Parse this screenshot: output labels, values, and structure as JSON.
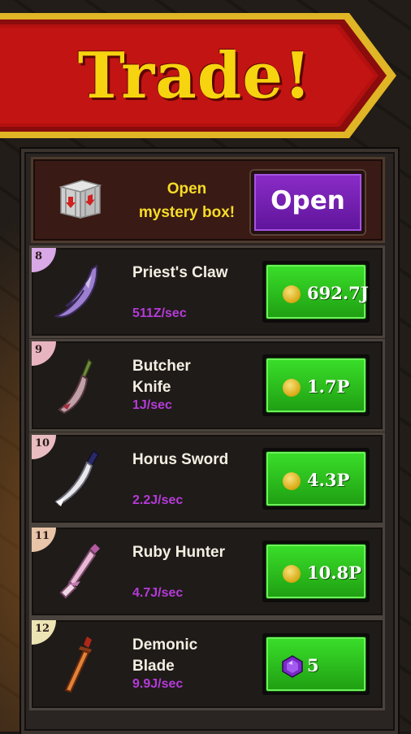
{
  "header": {
    "title": "Trade!"
  },
  "mystery_box": {
    "line1": "Open",
    "line2": "mystery box!",
    "button_label": "Open",
    "icon": "crate-icon"
  },
  "items": [
    {
      "level": "8",
      "name": "Priest's Claw",
      "rate": "511Z/sec",
      "price": "692.7J",
      "currency": "coin",
      "badge_color": "#d9a8e6"
    },
    {
      "level": "9",
      "name": "Butcher Knife",
      "rate": "1J/sec",
      "price": "1.7P",
      "currency": "coin",
      "badge_color": "#e8b4c0"
    },
    {
      "level": "10",
      "name": "Horus Sword",
      "rate": "2.2J/sec",
      "price": "4.3P",
      "currency": "coin",
      "badge_color": "#e8bcc0"
    },
    {
      "level": "11",
      "name": "Ruby Hunter",
      "rate": "4.7J/sec",
      "price": "10.8P",
      "currency": "coin",
      "badge_color": "#e8c4a8"
    },
    {
      "level": "12",
      "name": "Demonic Blade",
      "rate": "9.9J/sec",
      "price": "5",
      "currency": "gem",
      "badge_color": "#ece4b4"
    }
  ]
}
